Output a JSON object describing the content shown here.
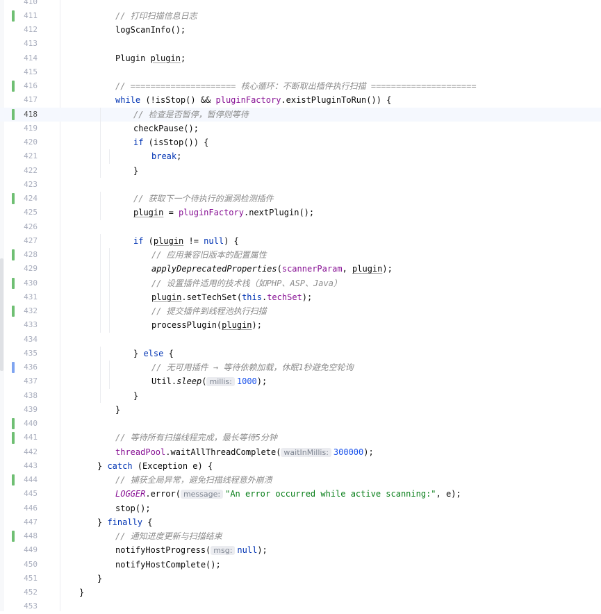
{
  "editor": {
    "current_line": "418",
    "indent_unit_chars": 4,
    "lines": [
      {
        "no": "410",
        "indent": 0,
        "vcs": null,
        "tokens": []
      },
      {
        "no": "411",
        "indent": 5,
        "vcs": "added",
        "tokens": [
          {
            "t": "// 打印扫描信息日志",
            "c": "cm"
          }
        ]
      },
      {
        "no": "412",
        "indent": 5,
        "vcs": null,
        "tokens": [
          {
            "t": "logScanInfo();",
            "c": ""
          }
        ]
      },
      {
        "no": "413",
        "indent": 0,
        "vcs": null,
        "tokens": []
      },
      {
        "no": "414",
        "indent": 5,
        "vcs": null,
        "tokens": [
          {
            "t": "Plugin ",
            "c": ""
          },
          {
            "t": "plugin",
            "c": "ul"
          },
          {
            "t": ";",
            "c": ""
          }
        ]
      },
      {
        "no": "415",
        "indent": 0,
        "vcs": null,
        "tokens": []
      },
      {
        "no": "416",
        "indent": 5,
        "vcs": "added",
        "tokens": [
          {
            "t": "// ===================== 核心循环：不断取出插件执行扫描 =====================",
            "c": "cm"
          }
        ]
      },
      {
        "no": "417",
        "indent": 5,
        "vcs": null,
        "tokens": [
          {
            "t": "while",
            "c": "kw"
          },
          {
            "t": " (!isStop() && ",
            "c": ""
          },
          {
            "t": "pluginFactory",
            "c": "fld"
          },
          {
            "t": ".existPluginToRun()) {",
            "c": ""
          }
        ]
      },
      {
        "no": "418",
        "indent": 6,
        "vcs": "added",
        "tokens": [
          {
            "t": "// 检查是否暂停，暂停则等待",
            "c": "cm"
          }
        ]
      },
      {
        "no": "419",
        "indent": 6,
        "vcs": null,
        "tokens": [
          {
            "t": "checkPause();",
            "c": ""
          }
        ]
      },
      {
        "no": "420",
        "indent": 6,
        "vcs": null,
        "tokens": [
          {
            "t": "if",
            "c": "kw"
          },
          {
            "t": " (isStop()) {",
            "c": ""
          }
        ]
      },
      {
        "no": "421",
        "indent": 7,
        "vcs": null,
        "tokens": [
          {
            "t": "break",
            "c": "kw"
          },
          {
            "t": ";",
            "c": ""
          }
        ]
      },
      {
        "no": "422",
        "indent": 6,
        "vcs": null,
        "tokens": [
          {
            "t": "}",
            "c": ""
          }
        ]
      },
      {
        "no": "423",
        "indent": 0,
        "vcs": null,
        "tokens": []
      },
      {
        "no": "424",
        "indent": 6,
        "vcs": "added",
        "tokens": [
          {
            "t": "// 获取下一个待执行的漏洞检测插件",
            "c": "cm"
          }
        ]
      },
      {
        "no": "425",
        "indent": 6,
        "vcs": null,
        "tokens": [
          {
            "t": "plugin",
            "c": "ul"
          },
          {
            "t": " = ",
            "c": ""
          },
          {
            "t": "pluginFactory",
            "c": "fld"
          },
          {
            "t": ".nextPlugin();",
            "c": ""
          }
        ]
      },
      {
        "no": "426",
        "indent": 0,
        "vcs": null,
        "tokens": []
      },
      {
        "no": "427",
        "indent": 6,
        "vcs": null,
        "tokens": [
          {
            "t": "if",
            "c": "kw"
          },
          {
            "t": " (",
            "c": ""
          },
          {
            "t": "plugin",
            "c": "ul"
          },
          {
            "t": " != ",
            "c": ""
          },
          {
            "t": "null",
            "c": "kw"
          },
          {
            "t": ") {",
            "c": ""
          }
        ]
      },
      {
        "no": "428",
        "indent": 7,
        "vcs": "added",
        "tokens": [
          {
            "t": "// 应用兼容旧版本的配置属性",
            "c": "cm"
          }
        ]
      },
      {
        "no": "429",
        "indent": 7,
        "vcs": null,
        "tokens": [
          {
            "t": "applyDeprecatedProperties",
            "c": "it"
          },
          {
            "t": "(",
            "c": ""
          },
          {
            "t": "scannerParam",
            "c": "fld"
          },
          {
            "t": ", ",
            "c": ""
          },
          {
            "t": "plugin",
            "c": "ul"
          },
          {
            "t": ");",
            "c": ""
          }
        ]
      },
      {
        "no": "430",
        "indent": 7,
        "vcs": "added",
        "tokens": [
          {
            "t": "// 设置插件适用的技术栈（如PHP、ASP、Java）",
            "c": "cm"
          }
        ]
      },
      {
        "no": "431",
        "indent": 7,
        "vcs": null,
        "tokens": [
          {
            "t": "plugin",
            "c": "ul"
          },
          {
            "t": ".setTechSet(",
            "c": ""
          },
          {
            "t": "this",
            "c": "kw"
          },
          {
            "t": ".",
            "c": ""
          },
          {
            "t": "techSet",
            "c": "fld"
          },
          {
            "t": ");",
            "c": ""
          }
        ]
      },
      {
        "no": "432",
        "indent": 7,
        "vcs": "added",
        "tokens": [
          {
            "t": "// 提交插件到线程池执行扫描",
            "c": "cm"
          }
        ]
      },
      {
        "no": "433",
        "indent": 7,
        "vcs": null,
        "tokens": [
          {
            "t": "processPlugin(",
            "c": ""
          },
          {
            "t": "plugin",
            "c": "ul"
          },
          {
            "t": ");",
            "c": ""
          }
        ]
      },
      {
        "no": "434",
        "indent": 0,
        "vcs": null,
        "tokens": []
      },
      {
        "no": "435",
        "indent": 6,
        "vcs": null,
        "tokens": [
          {
            "t": "} ",
            "c": ""
          },
          {
            "t": "else",
            "c": "kw"
          },
          {
            "t": " {",
            "c": ""
          }
        ]
      },
      {
        "no": "436",
        "indent": 7,
        "vcs": "modified",
        "tokens": [
          {
            "t": "// 无可用插件 → 等待依赖加载，休眠1秒避免空轮询",
            "c": "cm"
          }
        ]
      },
      {
        "no": "437",
        "indent": 7,
        "vcs": null,
        "tokens": [
          {
            "t": "Util.",
            "c": ""
          },
          {
            "t": "sleep",
            "c": "it"
          },
          {
            "t": "(",
            "c": ""
          },
          {
            "t": "millis:",
            "c": "hint"
          },
          {
            "t": "1000",
            "c": "num"
          },
          {
            "t": ");",
            "c": ""
          }
        ]
      },
      {
        "no": "438",
        "indent": 6,
        "vcs": null,
        "tokens": [
          {
            "t": "}",
            "c": ""
          }
        ]
      },
      {
        "no": "439",
        "indent": 5,
        "vcs": null,
        "tokens": [
          {
            "t": "}",
            "c": ""
          }
        ]
      },
      {
        "no": "440",
        "indent": 0,
        "vcs": "added",
        "tokens": []
      },
      {
        "no": "441",
        "indent": 5,
        "vcs": "added",
        "tokens": [
          {
            "t": "// 等待所有扫描线程完成，最长等待5分钟",
            "c": "cm"
          }
        ]
      },
      {
        "no": "442",
        "indent": 5,
        "vcs": null,
        "tokens": [
          {
            "t": "threadPool",
            "c": "fld"
          },
          {
            "t": ".waitAllThreadComplete(",
            "c": ""
          },
          {
            "t": "waitInMillis:",
            "c": "hint"
          },
          {
            "t": "300000",
            "c": "num"
          },
          {
            "t": ");",
            "c": ""
          }
        ]
      },
      {
        "no": "443",
        "indent": 4,
        "vcs": null,
        "tokens": [
          {
            "t": "} ",
            "c": ""
          },
          {
            "t": "catch",
            "c": "kw"
          },
          {
            "t": " (Exception e) {",
            "c": ""
          }
        ]
      },
      {
        "no": "444",
        "indent": 5,
        "vcs": "added",
        "tokens": [
          {
            "t": "// 捕获全局异常，避免扫描线程意外崩溃",
            "c": "cm"
          }
        ]
      },
      {
        "no": "445",
        "indent": 5,
        "vcs": null,
        "tokens": [
          {
            "t": "LOGGER",
            "c": "fld it"
          },
          {
            "t": ".error(",
            "c": ""
          },
          {
            "t": "message:",
            "c": "hint"
          },
          {
            "t": "\"An error occurred while active scanning:\"",
            "c": "st"
          },
          {
            "t": ", e);",
            "c": ""
          }
        ]
      },
      {
        "no": "446",
        "indent": 5,
        "vcs": null,
        "tokens": [
          {
            "t": "stop();",
            "c": ""
          }
        ]
      },
      {
        "no": "447",
        "indent": 4,
        "vcs": null,
        "tokens": [
          {
            "t": "} ",
            "c": ""
          },
          {
            "t": "finally",
            "c": "kw"
          },
          {
            "t": " {",
            "c": ""
          }
        ]
      },
      {
        "no": "448",
        "indent": 5,
        "vcs": "added",
        "tokens": [
          {
            "t": "// 通知进度更新与扫描结束",
            "c": "cm"
          }
        ]
      },
      {
        "no": "449",
        "indent": 5,
        "vcs": null,
        "tokens": [
          {
            "t": "notifyHostProgress(",
            "c": ""
          },
          {
            "t": "msg:",
            "c": "hint"
          },
          {
            "t": "null",
            "c": "kw"
          },
          {
            "t": ");",
            "c": ""
          }
        ]
      },
      {
        "no": "450",
        "indent": 5,
        "vcs": null,
        "tokens": [
          {
            "t": "notifyHostComplete();",
            "c": ""
          }
        ]
      },
      {
        "no": "451",
        "indent": 4,
        "vcs": null,
        "tokens": [
          {
            "t": "}",
            "c": ""
          }
        ]
      },
      {
        "no": "452",
        "indent": 3,
        "vcs": null,
        "tokens": [
          {
            "t": "}",
            "c": ""
          }
        ]
      },
      {
        "no": "453",
        "indent": 0,
        "vcs": null,
        "tokens": []
      }
    ]
  }
}
